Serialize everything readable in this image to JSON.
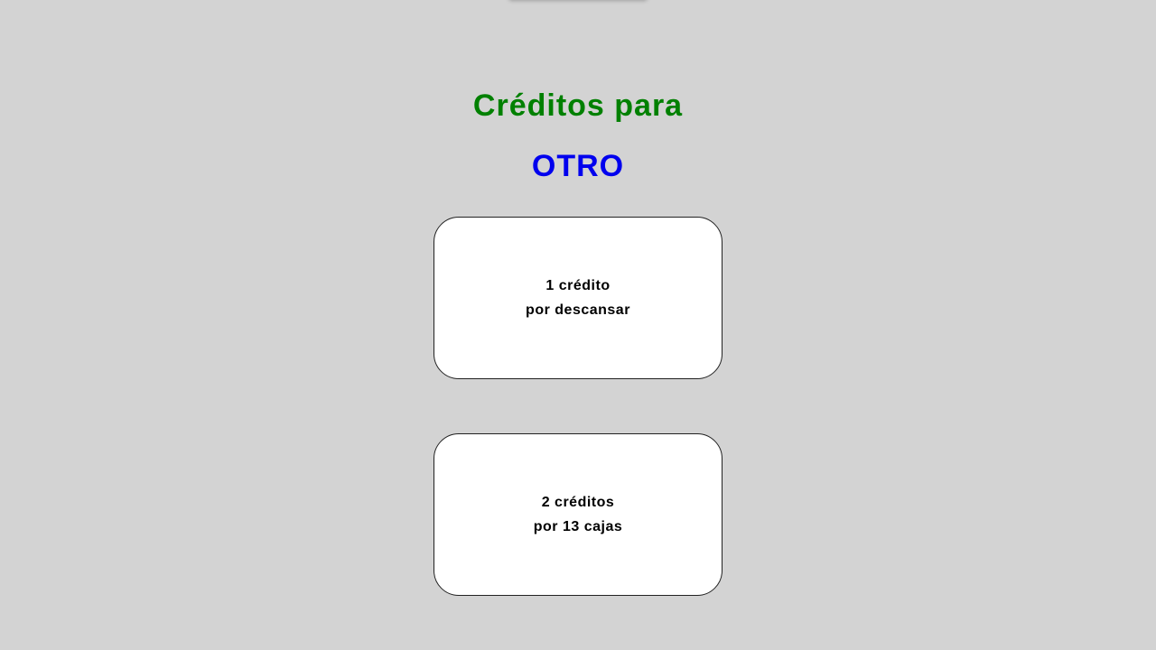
{
  "header": {
    "title": "Créditos para",
    "subject": "OTRO"
  },
  "options": [
    {
      "line1": "1 crédito",
      "line2": "por descansar"
    },
    {
      "line1": "2 créditos",
      "line2": "por 13 cajas"
    }
  ],
  "colors": {
    "background": "#d3d3d3",
    "title": "#008000",
    "subject": "#0000ee",
    "card": "#ffffff"
  }
}
